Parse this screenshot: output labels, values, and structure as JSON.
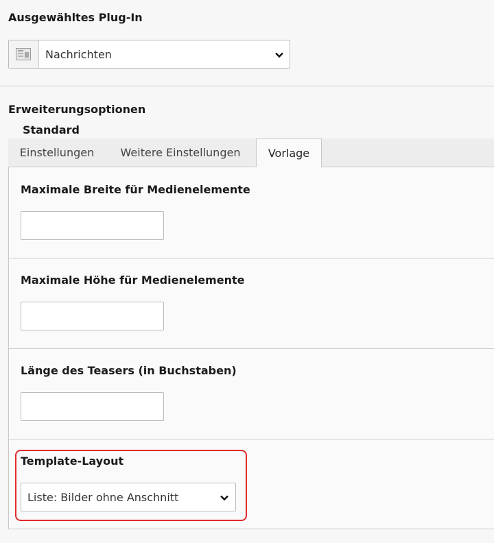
{
  "selected_plugin": {
    "label": "Ausgewähltes Plug-In",
    "value": "Nachrichten",
    "icon": "plugin-icon"
  },
  "extension_options": {
    "label": "Erweiterungsoptionen",
    "sheet_title": "Standard"
  },
  "tabs": [
    {
      "label": "Einstellungen",
      "active": false
    },
    {
      "label": "Weitere Einstellungen",
      "active": false
    },
    {
      "label": "Vorlage",
      "active": true
    }
  ],
  "fields": {
    "max_media_width": {
      "label": "Maximale Breite für Medienelemente",
      "value": ""
    },
    "max_media_height": {
      "label": "Maximale Höhe für Medienelemente",
      "value": ""
    },
    "teaser_length": {
      "label": "Länge des Teasers (in Buchstaben)",
      "value": ""
    },
    "template_layout": {
      "label": "Template-Layout",
      "value": "Liste: Bilder ohne Anschnitt"
    }
  },
  "colors": {
    "highlight": "#e02a2a",
    "background": "#f7f7f7"
  }
}
